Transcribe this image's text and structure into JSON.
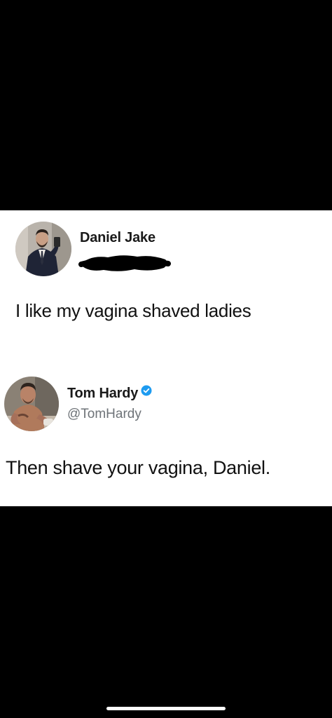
{
  "tweet1": {
    "author_name": "Daniel Jake",
    "text": "I like my vagina shaved ladies"
  },
  "tweet2": {
    "author_name": "Tom Hardy",
    "handle": "@TomHardy",
    "text": "Then shave your vagina, Daniel.",
    "verified": true
  },
  "colors": {
    "background": "#000000",
    "card": "#ffffff",
    "verified_badge": "#1d9bf0",
    "handle_text": "#6e7378"
  }
}
